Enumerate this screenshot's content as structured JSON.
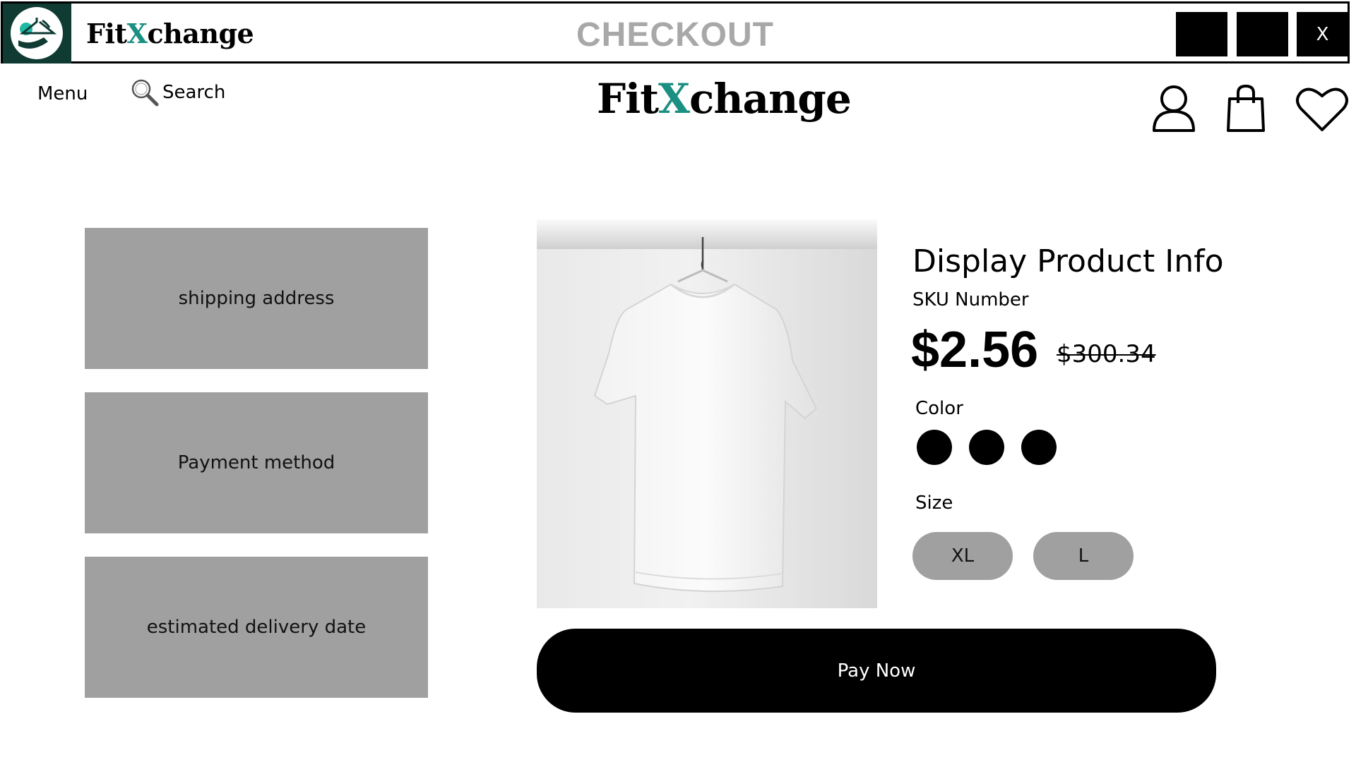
{
  "window": {
    "app_name_prefix": "Fit",
    "app_name_accent": "X",
    "app_name_suffix": "change",
    "title": "CHECKOUT",
    "minimize_label": "",
    "maximize_label": "",
    "close_label": "X"
  },
  "header": {
    "menu_label": "Menu",
    "search_label": "Search",
    "brand_prefix": "Fit",
    "brand_accent": "X",
    "brand_suffix": "change",
    "icons": [
      "user-icon",
      "shopping-bag-icon",
      "heart-icon"
    ]
  },
  "checkout": {
    "shipping_label": "shipping address",
    "payment_label": "Payment method",
    "delivery_label": "estimated delivery date"
  },
  "product": {
    "title": "Display Product Info",
    "sku": "SKU Number",
    "price": "$2.56",
    "original_price": "$300.34",
    "color_label": "Color",
    "size_label": "Size",
    "sizes": [
      "XL",
      "L"
    ],
    "swatch_count": 3
  },
  "actions": {
    "pay_label": "Pay Now"
  },
  "colors": {
    "accent": "#1a8f82",
    "logo_bg": "#0f3b33",
    "box_gray": "#a0a0a0",
    "title_gray": "#a8a8a8"
  }
}
